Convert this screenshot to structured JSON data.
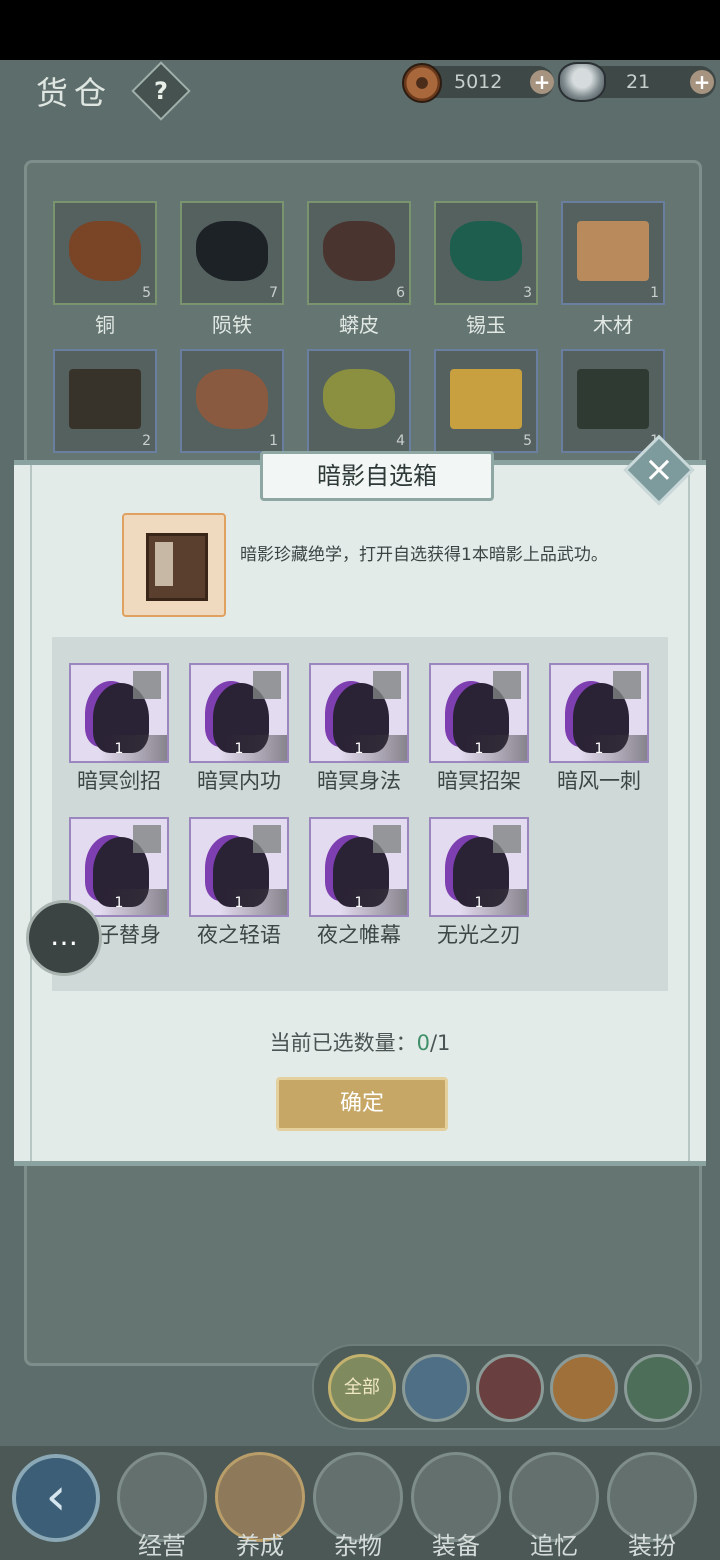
{
  "header": {
    "title": "货仓",
    "help_label": "?",
    "copper": {
      "value": "5012",
      "icon": "copper-coin-icon"
    },
    "silver": {
      "value": "21",
      "icon": "silver-ingot-icon"
    },
    "plus_label": "+"
  },
  "warehouse": {
    "items": [
      {
        "name": "铜",
        "count": "5",
        "color": "#7a4426"
      },
      {
        "name": "陨铁",
        "count": "7",
        "color": "#1d2226"
      },
      {
        "name": "蟒皮",
        "count": "6",
        "color": "#4a3430"
      },
      {
        "name": "锡玉",
        "count": "3",
        "color": "#1e5e4e"
      },
      {
        "name": "木材",
        "count": "1",
        "color": "#b88a5c"
      },
      {
        "name": "",
        "count": "2",
        "color": "#38332a"
      },
      {
        "name": "",
        "count": "1",
        "color": "#8a5a40"
      },
      {
        "name": "",
        "count": "4",
        "color": "#8a9040"
      },
      {
        "name": "",
        "count": "5",
        "color": "#c9a040"
      },
      {
        "name": "",
        "count": "1",
        "color": "#2f3a33"
      }
    ]
  },
  "modal": {
    "title": "暗影自选箱",
    "close_icon": "close-icon",
    "description": "暗影珍藏绝学，打开自选获得1本暗影上品武功。",
    "skills": [
      {
        "name": "暗冥剑招",
        "count": "1"
      },
      {
        "name": "暗冥内功",
        "count": "1"
      },
      {
        "name": "暗冥身法",
        "count": "1"
      },
      {
        "name": "暗冥招架",
        "count": "1"
      },
      {
        "name": "暗风一刺",
        "count": "1"
      },
      {
        "name": "影子替身",
        "count": "1"
      },
      {
        "name": "夜之轻语",
        "count": "1"
      },
      {
        "name": "夜之帷幕",
        "count": "1"
      },
      {
        "name": "无光之刃",
        "count": "1"
      }
    ],
    "selected_label": "当前已选数量：",
    "selected_current": "0",
    "selected_max": "/1",
    "confirm_label": "确定"
  },
  "filters": [
    {
      "name": "filter-all",
      "label": "全部"
    },
    {
      "name": "filter-bag",
      "label": ""
    },
    {
      "name": "filter-weapon",
      "label": ""
    },
    {
      "name": "filter-material",
      "label": ""
    },
    {
      "name": "filter-umbrella",
      "label": ""
    }
  ],
  "nav": [
    {
      "label": "经营"
    },
    {
      "label": "养成"
    },
    {
      "label": "杂物"
    },
    {
      "label": "装备"
    },
    {
      "label": "追忆"
    },
    {
      "label": "装扮"
    }
  ],
  "colors": {
    "accent_gold": "#c6a766",
    "selected_green": "#3f8f6a",
    "modal_bg": "#e3ebe9"
  }
}
